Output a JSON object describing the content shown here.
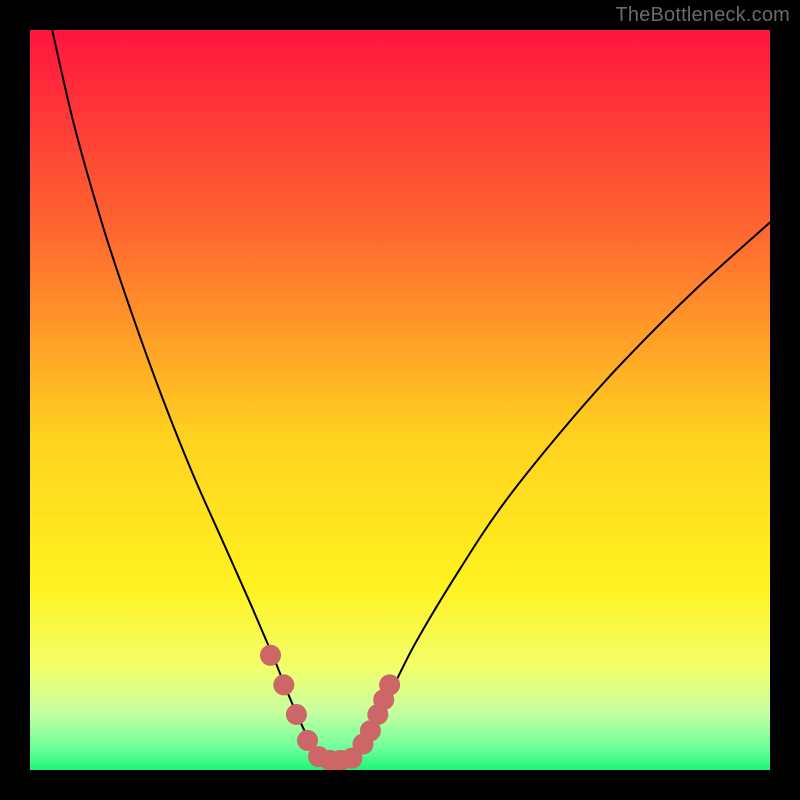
{
  "watermark": "TheBottleneck.com",
  "colors": {
    "frame_bg": "#000000",
    "grad_top": "#ff153e",
    "grad_mid1": "#ff7a2d",
    "grad_mid2": "#ffee1f",
    "grad_low": "#f6ff6e",
    "grad_band": "#d8ff9b",
    "grad_bottom": "#1ef577",
    "curve": "#000000",
    "marker_fill": "#cc6667",
    "marker_stroke": "#cc6667"
  },
  "chart_data": {
    "type": "line",
    "title": "",
    "xlabel": "",
    "ylabel": "",
    "xlim": [
      0,
      100
    ],
    "ylim": [
      0,
      100
    ],
    "grid": false,
    "legend": false,
    "series": [
      {
        "name": "bottleneck-curve",
        "x": [
          3,
          6,
          10,
          14,
          18,
          22,
          26,
          30,
          33,
          35,
          37,
          38.5,
          40,
          41.5,
          43,
          45,
          48,
          52,
          58,
          64,
          72,
          80,
          90,
          100
        ],
        "y": [
          100,
          87,
          73,
          61,
          50,
          40,
          31,
          22,
          15,
          10,
          5.5,
          2.7,
          1.3,
          1.3,
          1.3,
          3.5,
          9,
          17,
          27,
          36,
          46,
          55,
          65,
          74
        ]
      }
    ],
    "markers": {
      "name": "highlighted-points",
      "x": [
        32.5,
        34.3,
        36,
        37.5,
        39,
        40.5,
        42,
        43.5,
        45,
        46,
        47,
        47.8,
        48.6
      ],
      "y": [
        15.5,
        11.5,
        7.5,
        4,
        1.8,
        1.3,
        1.3,
        1.6,
        3.5,
        5.3,
        7.5,
        9.5,
        11.5
      ],
      "radius": 10
    },
    "background_gradient_stops": [
      {
        "offset": 0,
        "color": "#ff153e"
      },
      {
        "offset": 28,
        "color": "#ff6a2f"
      },
      {
        "offset": 55,
        "color": "#ffd21f"
      },
      {
        "offset": 75,
        "color": "#fff21f"
      },
      {
        "offset": 86,
        "color": "#f3ff6a"
      },
      {
        "offset": 92,
        "color": "#c9ffa0"
      },
      {
        "offset": 97,
        "color": "#6eff9b"
      },
      {
        "offset": 100,
        "color": "#1ef577"
      }
    ]
  }
}
